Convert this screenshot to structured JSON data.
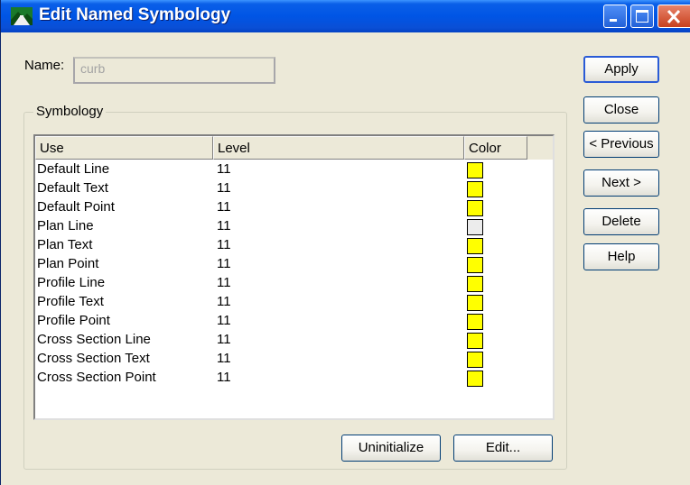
{
  "window": {
    "title": "Edit Named Symbology",
    "app_icon": "landscape-app-icon",
    "controls": [
      "minimize-icon",
      "maximize-icon",
      "close-icon"
    ]
  },
  "name_field": {
    "label": "Name:",
    "value": "curb"
  },
  "symbology": {
    "group_label": "Symbology",
    "columns": {
      "use": "Use",
      "level": "Level",
      "color": "Color"
    },
    "rows": [
      {
        "use": "Default Line",
        "level": "11",
        "color": "#ffff00"
      },
      {
        "use": "Default Text",
        "level": "11",
        "color": "#ffff00"
      },
      {
        "use": "Default Point",
        "level": "11",
        "color": "#ffff00"
      },
      {
        "use": "Plan Line",
        "level": "11",
        "color": "#ececec"
      },
      {
        "use": "Plan Text",
        "level": "11",
        "color": "#ffff00"
      },
      {
        "use": "Plan Point",
        "level": "11",
        "color": "#ffff00"
      },
      {
        "use": "Profile Line",
        "level": "11",
        "color": "#ffff00"
      },
      {
        "use": "Profile Text",
        "level": "11",
        "color": "#ffff00"
      },
      {
        "use": "Profile Point",
        "level": "11",
        "color": "#ffff00"
      },
      {
        "use": "Cross Section Line",
        "level": "11",
        "color": "#ffff00"
      },
      {
        "use": "Cross Section Text",
        "level": "11",
        "color": "#ffff00"
      },
      {
        "use": "Cross Section Point",
        "level": "11",
        "color": "#ffff00"
      }
    ],
    "buttons": {
      "uninitialize": "Uninitialize",
      "edit": "Edit..."
    }
  },
  "side_buttons": {
    "apply": "Apply",
    "close": "Close",
    "previous": "< Previous",
    "next": "Next >",
    "delete": "Delete",
    "help": "Help"
  },
  "colors": {
    "titlebar": "#0055e5",
    "dialog_bg": "#ece9d8",
    "symbol_yellow": "#ffff00"
  }
}
